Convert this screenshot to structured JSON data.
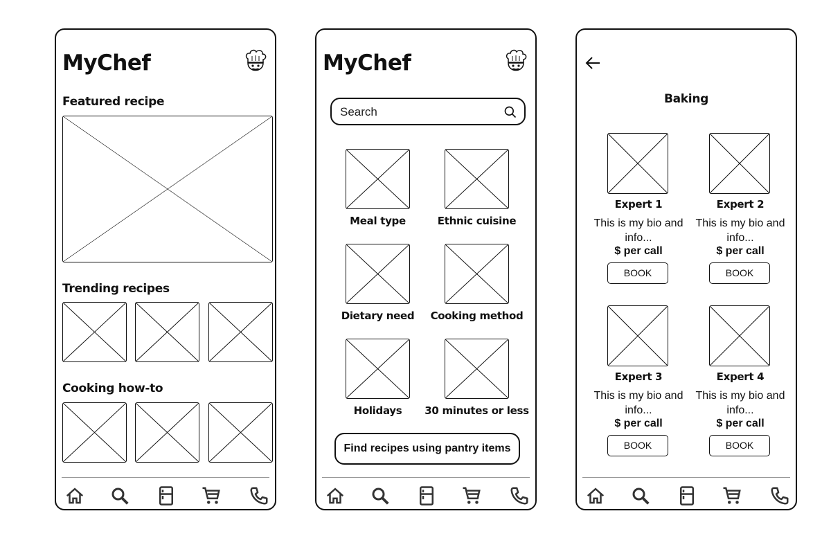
{
  "app_name": "MyChef",
  "home": {
    "featured_title": "Featured recipe",
    "trending_title": "Trending recipes",
    "howto_title": "Cooking how-to"
  },
  "explore": {
    "search_placeholder": "Search",
    "categories": [
      {
        "label": "Meal type"
      },
      {
        "label": "Ethnic cuisine"
      },
      {
        "label": "Dietary need"
      },
      {
        "label": "Cooking method"
      },
      {
        "label": "Holidays"
      },
      {
        "label": "30 minutes or less"
      }
    ],
    "pantry_button": "Find recipes using pantry items"
  },
  "experts_page": {
    "title": "Baking",
    "experts": [
      {
        "name": "Expert 1",
        "bio": "This is my bio and info...",
        "price": "$ per call",
        "action": "BOOK"
      },
      {
        "name": "Expert 2",
        "bio": "This is my bio and info...",
        "price": "$ per call",
        "action": "BOOK"
      },
      {
        "name": "Expert 3",
        "bio": "This is my bio and info...",
        "price": "$ per call",
        "action": "BOOK"
      },
      {
        "name": "Expert 4",
        "bio": "This is my bio and info...",
        "price": "$ per call",
        "action": "BOOK"
      }
    ]
  },
  "nav_icons": [
    "home-icon",
    "search-icon",
    "fridge-icon",
    "cart-icon",
    "phone-icon"
  ]
}
